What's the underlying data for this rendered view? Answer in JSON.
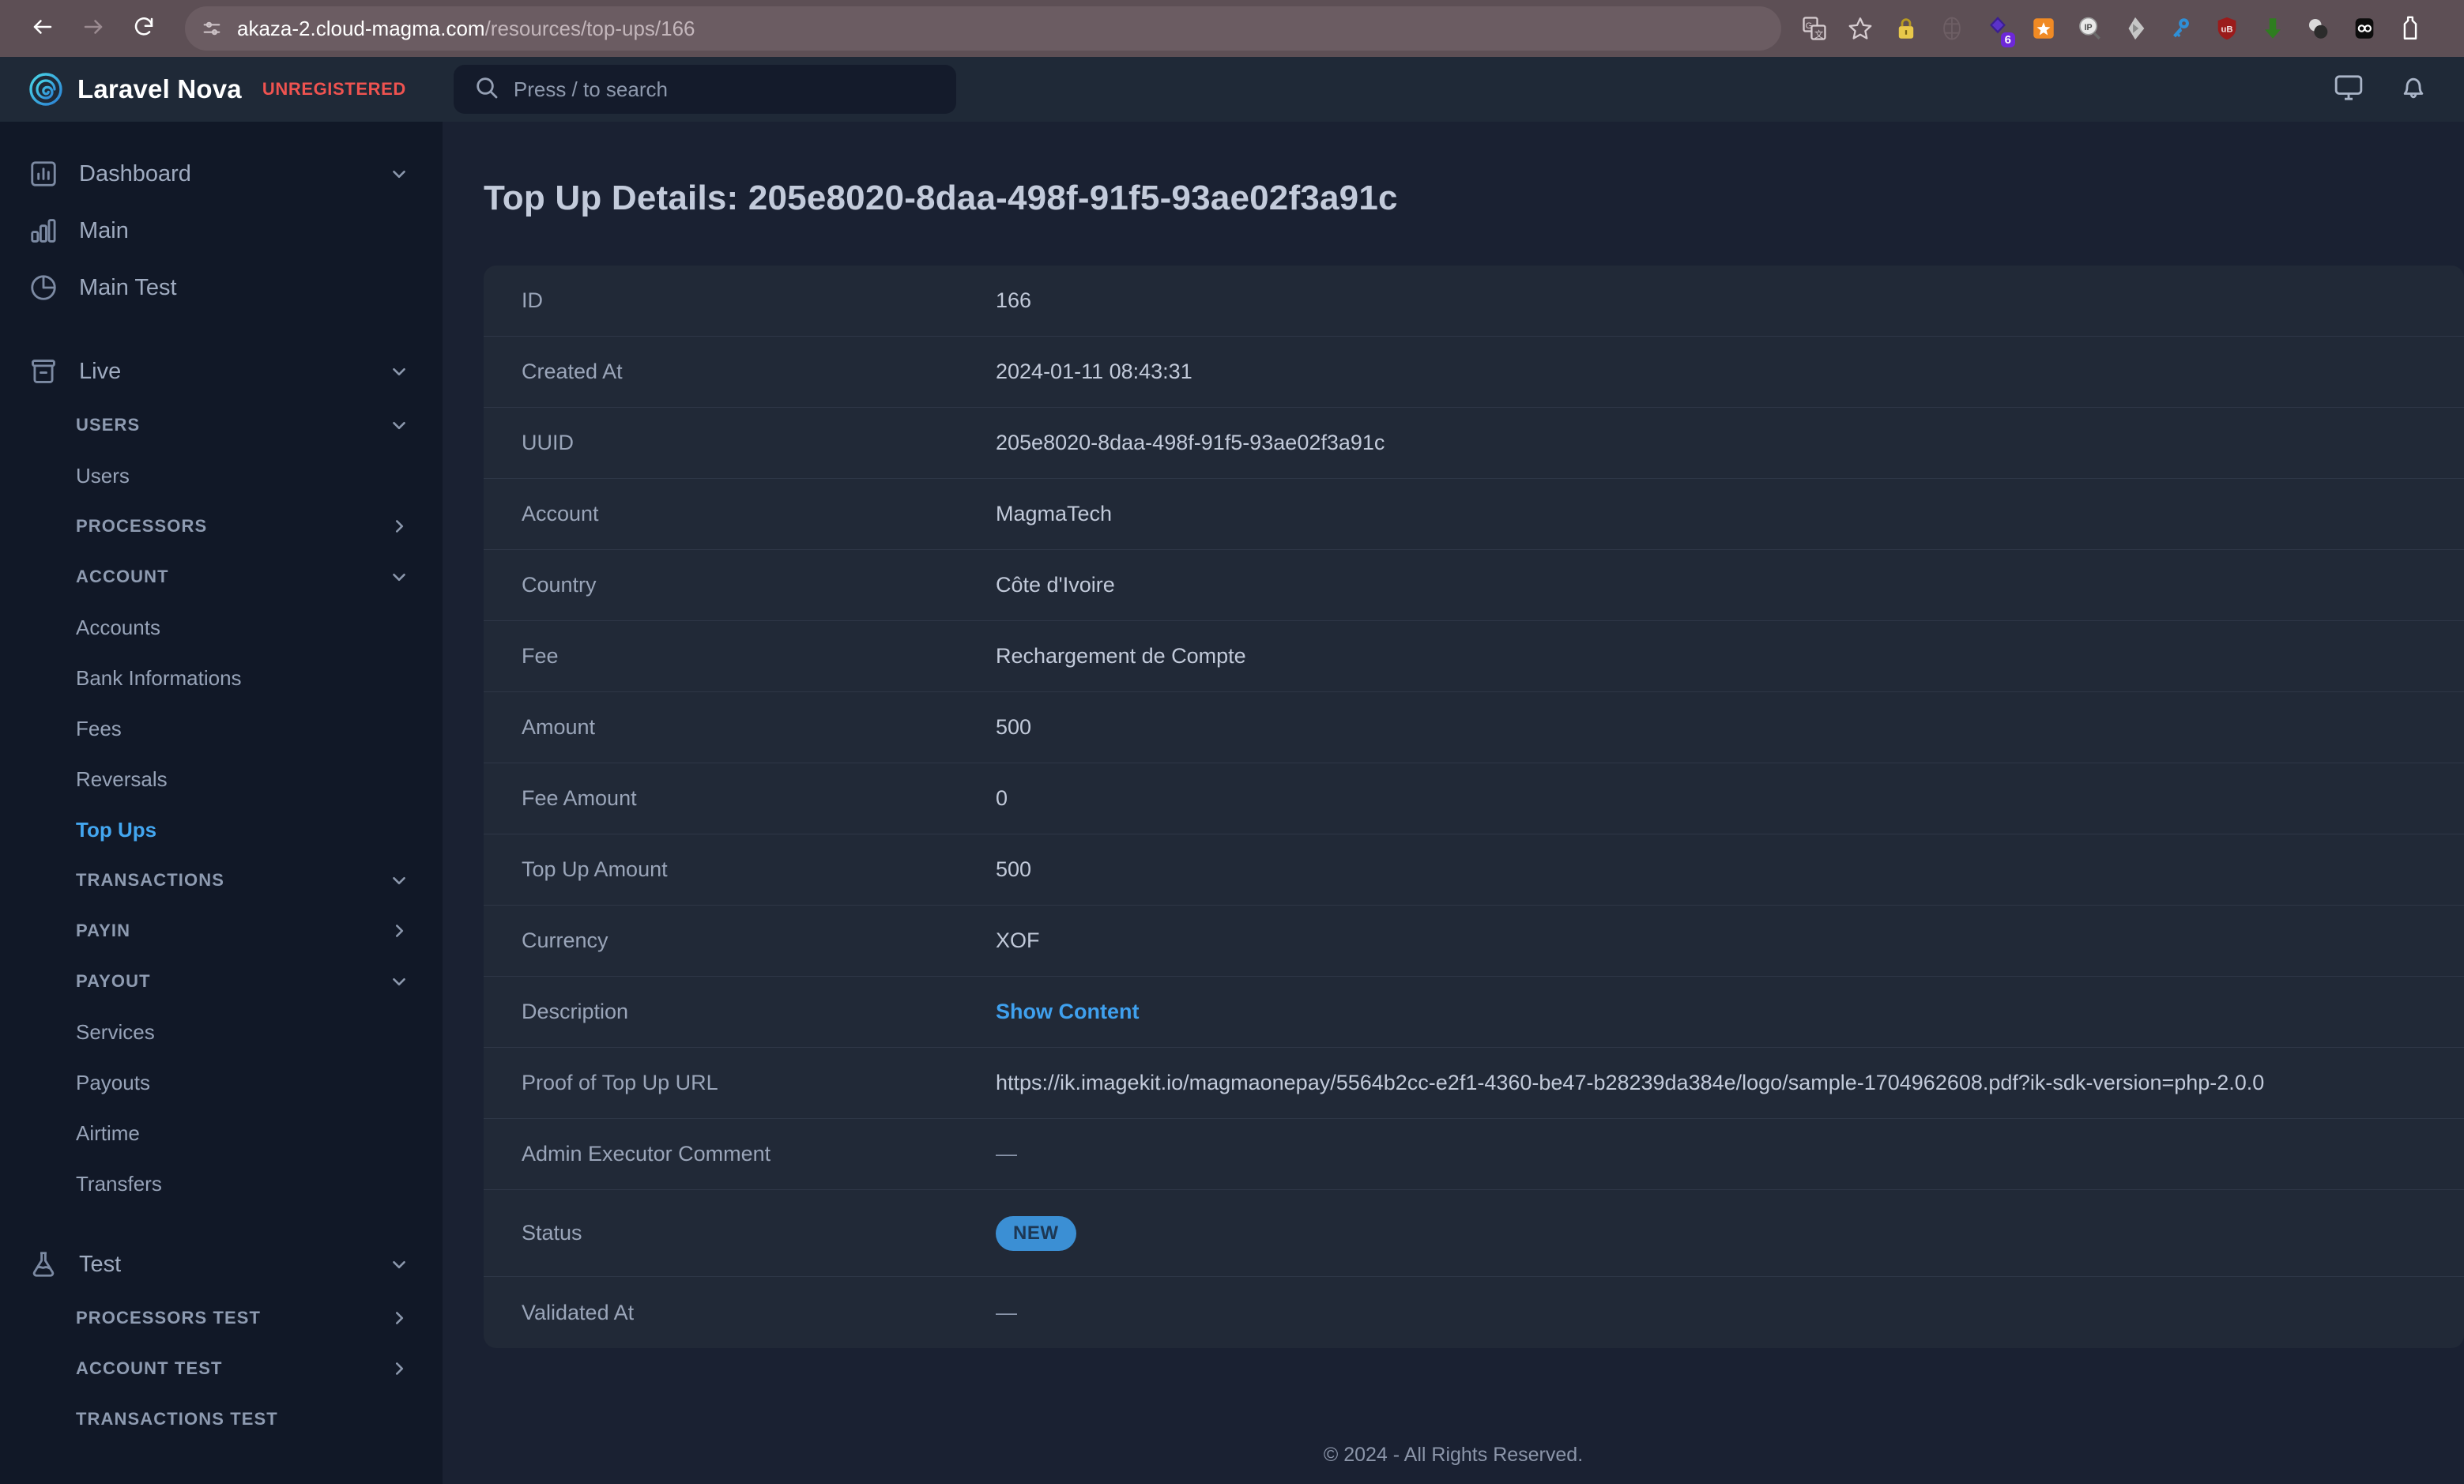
{
  "browser": {
    "back_icon": "back-arrow-icon",
    "forward_icon": "forward-arrow-icon",
    "reload_icon": "reload-icon",
    "site_info_icon": "site-settings-icon",
    "url_host": "akaza-2.cloud-magma.com",
    "url_path": "/resources/top-ups/166",
    "url_full": "akaza-2.cloud-magma.com/resources/top-ups/166",
    "toolbar_icons": [
      {
        "name": "translate-icon",
        "badge": ""
      },
      {
        "name": "bookmark-star-icon",
        "badge": ""
      },
      {
        "name": "padlock-extension-icon",
        "badge": ""
      },
      {
        "name": "palm-tree-extension-icon",
        "badge": ""
      },
      {
        "name": "purple-diamond-extension-icon",
        "badge": "6"
      },
      {
        "name": "orange-star-extension-icon",
        "badge": ""
      },
      {
        "name": "ip-lookup-extension-icon",
        "badge": ""
      },
      {
        "name": "grey-arrow-extension-icon",
        "badge": ""
      },
      {
        "name": "key-extension-icon",
        "badge": ""
      },
      {
        "name": "red-shield-ub-extension-icon",
        "badge": ""
      },
      {
        "name": "green-download-extension-icon",
        "badge": ""
      },
      {
        "name": "spheres-extension-icon",
        "badge": ""
      },
      {
        "name": "black-oo-extension-icon",
        "badge": ""
      },
      {
        "name": "white-bottle-extension-icon",
        "badge": ""
      }
    ]
  },
  "header": {
    "logo_icon": "laravel-nova-spiral-logo",
    "brand": "Laravel Nova",
    "license_badge": "UNREGISTERED",
    "search_icon": "search-icon",
    "search_placeholder": "Press / to search",
    "search_value": "",
    "screen_icon": "monitor-icon",
    "bell_icon": "bell-icon"
  },
  "sidebar": {
    "groups": [
      {
        "type": "top",
        "icon": "bar-chart-box-icon",
        "label": "Dashboard",
        "chevron": "chevron-down-icon"
      },
      {
        "type": "top",
        "icon": "bar-chart-icon",
        "label": "Main",
        "chevron": ""
      },
      {
        "type": "top",
        "icon": "pie-chart-icon",
        "label": "Main Test",
        "chevron": ""
      },
      {
        "type": "spacer"
      },
      {
        "type": "top",
        "icon": "archive-box-icon",
        "label": "Live",
        "chevron": "chevron-down-icon"
      },
      {
        "type": "section",
        "label": "USERS",
        "chevron": "chevron-down-icon"
      },
      {
        "type": "item",
        "label": "Users",
        "active": false
      },
      {
        "type": "section",
        "label": "PROCESSORS",
        "chevron": "chevron-right-icon"
      },
      {
        "type": "section",
        "label": "ACCOUNT",
        "chevron": "chevron-down-icon"
      },
      {
        "type": "item",
        "label": "Accounts",
        "active": false
      },
      {
        "type": "item",
        "label": "Bank Informations",
        "active": false
      },
      {
        "type": "item",
        "label": "Fees",
        "active": false
      },
      {
        "type": "item",
        "label": "Reversals",
        "active": false
      },
      {
        "type": "item",
        "label": "Top Ups",
        "active": true
      },
      {
        "type": "section",
        "label": "TRANSACTIONS",
        "chevron": "chevron-down-icon"
      },
      {
        "type": "section",
        "label": "PAYIN",
        "chevron": "chevron-right-icon"
      },
      {
        "type": "section",
        "label": "PAYOUT",
        "chevron": "chevron-down-icon"
      },
      {
        "type": "item",
        "label": "Services",
        "active": false
      },
      {
        "type": "item",
        "label": "Payouts",
        "active": false
      },
      {
        "type": "item",
        "label": "Airtime",
        "active": false
      },
      {
        "type": "item",
        "label": "Transfers",
        "active": false
      },
      {
        "type": "spacer"
      },
      {
        "type": "top",
        "icon": "flask-icon",
        "label": "Test",
        "chevron": "chevron-down-icon"
      },
      {
        "type": "section",
        "label": "PROCESSORS TEST",
        "chevron": "chevron-right-icon"
      },
      {
        "type": "section",
        "label": "ACCOUNT TEST",
        "chevron": "chevron-right-icon"
      },
      {
        "type": "section",
        "label": "TRANSACTIONS TEST",
        "chevron": ""
      }
    ]
  },
  "main": {
    "page_title": "Top Up Details: 205e8020-8daa-498f-91f5-93ae02f3a91c",
    "rows": [
      {
        "label": "ID",
        "value": "166",
        "kind": "text"
      },
      {
        "label": "Created At",
        "value": "2024-01-11 08:43:31",
        "kind": "text"
      },
      {
        "label": "UUID",
        "value": "205e8020-8daa-498f-91f5-93ae02f3a91c",
        "kind": "text"
      },
      {
        "label": "Account",
        "value": "MagmaTech",
        "kind": "text"
      },
      {
        "label": "Country",
        "value": "Côte d'Ivoire",
        "kind": "text"
      },
      {
        "label": "Fee",
        "value": "Rechargement de Compte",
        "kind": "text"
      },
      {
        "label": "Amount",
        "value": "500",
        "kind": "text"
      },
      {
        "label": "Fee Amount",
        "value": "0",
        "kind": "text"
      },
      {
        "label": "Top Up Amount",
        "value": "500",
        "kind": "text"
      },
      {
        "label": "Currency",
        "value": "XOF",
        "kind": "text"
      },
      {
        "label": "Description",
        "value": "Show Content",
        "kind": "link"
      },
      {
        "label": "Proof of Top Up URL",
        "value": "https://ik.imagekit.io/magmaonepay/5564b2cc-e2f1-4360-be47-b28239da384e/logo/sample-1704962608.pdf?ik-sdk-version=php-2.0.0",
        "kind": "text"
      },
      {
        "label": "Admin Executor Comment",
        "value": "—",
        "kind": "dash"
      },
      {
        "label": "Status",
        "value": "NEW",
        "kind": "badge"
      },
      {
        "label": "Validated At",
        "value": "—",
        "kind": "dash"
      }
    ],
    "footer": "© 2024 - All Rights Reserved."
  },
  "colors": {
    "page_bg": "#1a2132",
    "sidebar_bg": "#111827",
    "card_bg": "#212937",
    "header_bg": "#1f2937",
    "accent_link": "#43a6f0",
    "badge_new": "#3b8fd4",
    "unregistered": "#ef5350",
    "browser_chrome": "#5d4f55"
  }
}
